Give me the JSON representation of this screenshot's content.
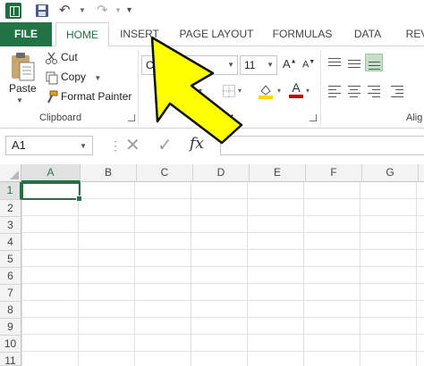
{
  "tabs": {
    "file": "FILE",
    "home": "HOME",
    "insert": "INSERT",
    "page_layout": "PAGE LAYOUT",
    "formulas": "FORMULAS",
    "data": "DATA",
    "review": "REV"
  },
  "clipboard": {
    "paste": "Paste",
    "cut": "Cut",
    "copy": "Copy",
    "format_painter": "Format Painter",
    "group_label": "Clipboard"
  },
  "font": {
    "name": "C",
    "size": "11",
    "grow": "A",
    "shrink": "A",
    "font_color_letter": "A",
    "group_label_partial": "nt"
  },
  "alignment": {
    "group_label_partial": "Alig"
  },
  "formula_bar": {
    "name_box": "A1",
    "fx": "fx",
    "formula_value": ""
  },
  "grid": {
    "columns": [
      "A",
      "B",
      "C",
      "D",
      "E",
      "F",
      "G"
    ],
    "rows": [
      "1",
      "2",
      "3",
      "4",
      "5",
      "6",
      "7",
      "8",
      "9",
      "10",
      "11"
    ],
    "active_cell": "A1"
  },
  "colors": {
    "excel_green": "#217346",
    "annotation_yellow": "#ffff00",
    "font_color_red": "#c00000",
    "fill_yellow": "#ffd600"
  }
}
